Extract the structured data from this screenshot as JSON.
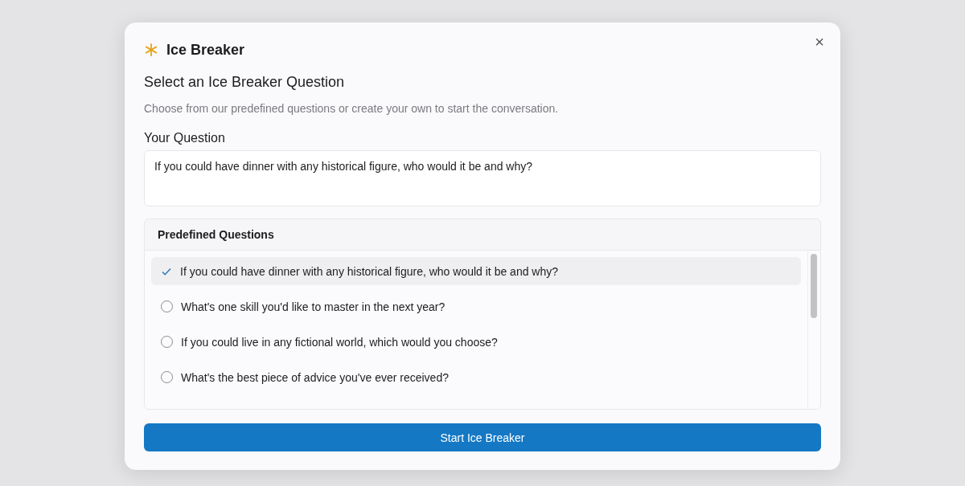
{
  "dialog": {
    "title": "Ice Breaker",
    "close": "×",
    "heading": "Select an Ice Breaker Question",
    "description": "Choose from our predefined questions or create your own to start the conversation.",
    "question_label": "Your Question",
    "question_value": "If you could have dinner with any historical figure, who would it be and why?",
    "predefined": {
      "title": "Predefined Questions",
      "items": [
        {
          "text": "If you could have dinner with any historical figure, who would it be and why?",
          "selected": true
        },
        {
          "text": "What's one skill you'd like to master in the next year?",
          "selected": false
        },
        {
          "text": "If you could live in any fictional world, which would you choose?",
          "selected": false
        },
        {
          "text": "What's the best piece of advice you've ever received?",
          "selected": false
        }
      ]
    },
    "button": "Start Ice Breaker"
  }
}
